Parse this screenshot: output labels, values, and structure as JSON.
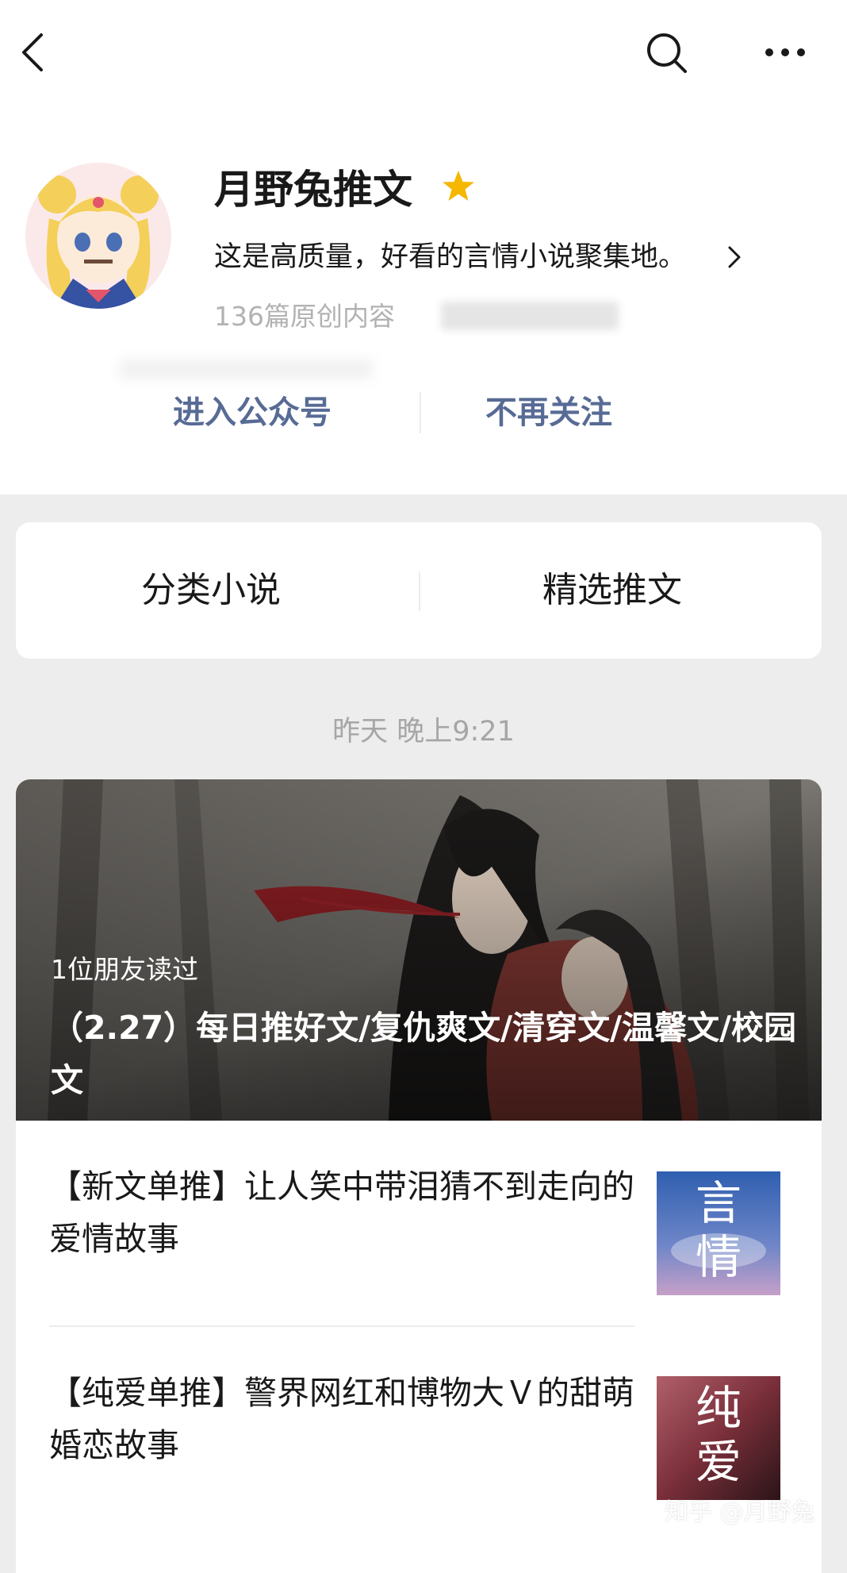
{
  "nav": {
    "back_icon": "chevron-left-icon",
    "search_icon": "search-icon",
    "more_icon": "more-dots-icon"
  },
  "profile": {
    "name": "月野兔推文",
    "star_icon": "star-icon",
    "description": "这是高质量，好看的言情小说聚集地。",
    "count_text": "136篇原创内容",
    "enter_label": "进入公众号",
    "unfollow_label": "不再关注"
  },
  "menu": {
    "items": [
      {
        "label": "分类小说"
      },
      {
        "label": "精选推文"
      }
    ]
  },
  "feed": {
    "timestamp": "昨天 晚上9:21",
    "main": {
      "read_by": "1位朋友读过",
      "title": "（2.27）每日推好文/复仇爽文/清穿文/温馨文/校园文"
    },
    "articles": [
      {
        "title": "【新文单推】让人笑中带泪猜不到走向的爱情故事",
        "thumb_text": [
          "言",
          "情"
        ]
      },
      {
        "title": "【纯爱单推】警界网红和博物大Ｖ的甜萌婚恋故事",
        "thumb_text": [
          "纯",
          "爱"
        ]
      }
    ]
  },
  "watermark": "知乎 @月野兔",
  "colors": {
    "link_blue": "#576b95",
    "star_yellow": "#f5b700",
    "text_primary": "#191919",
    "text_secondary": "#b2b2b2",
    "background": "#ededed"
  }
}
